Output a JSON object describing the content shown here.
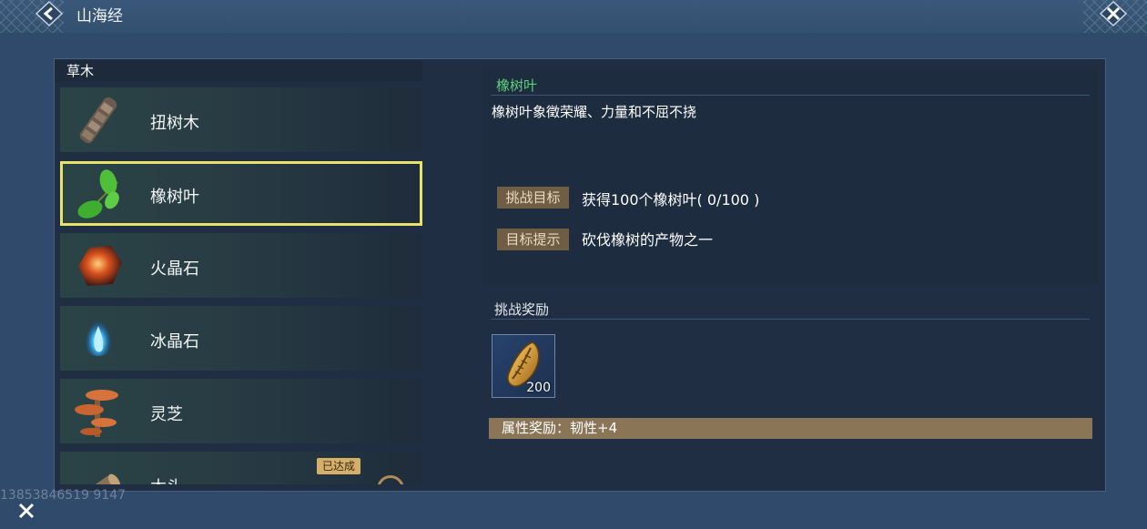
{
  "window": {
    "title": "山海经"
  },
  "left_panel": {
    "header": "草木",
    "items": [
      {
        "label": "扭树木",
        "icon": "twisted-wood-icon"
      },
      {
        "label": "橡树叶",
        "icon": "oak-leaf-icon",
        "selected": true
      },
      {
        "label": "火晶石",
        "icon": "fire-crystal-icon"
      },
      {
        "label": "冰晶石",
        "icon": "ice-crystal-icon"
      },
      {
        "label": "灵芝",
        "icon": "lingzhi-mushroom-icon"
      },
      {
        "label": "木头",
        "icon": "wood-log-icon",
        "badge": "已达成"
      }
    ]
  },
  "detail": {
    "title": "橡树叶",
    "description": "橡树叶象徵荣耀、力量和不屈不挠",
    "goal_tag": "挑战目标",
    "goal_text": "获得100个橡树叶( 0/100 )",
    "hint_tag": "目标提示",
    "hint_text": "砍伐橡树的产物之一"
  },
  "reward": {
    "title": "挑战奖励",
    "item_icon": "golden-seed-icon",
    "item_count": "200",
    "attribute_bonus": "属性奖励：韧性+4"
  },
  "watermark": "13853846519 9147",
  "colors": {
    "accent_green": "#5fd17a",
    "selected_border": "#e9e26a",
    "tag_bg": "#6f5e44",
    "attr_bar_bg": "#8a7657"
  }
}
